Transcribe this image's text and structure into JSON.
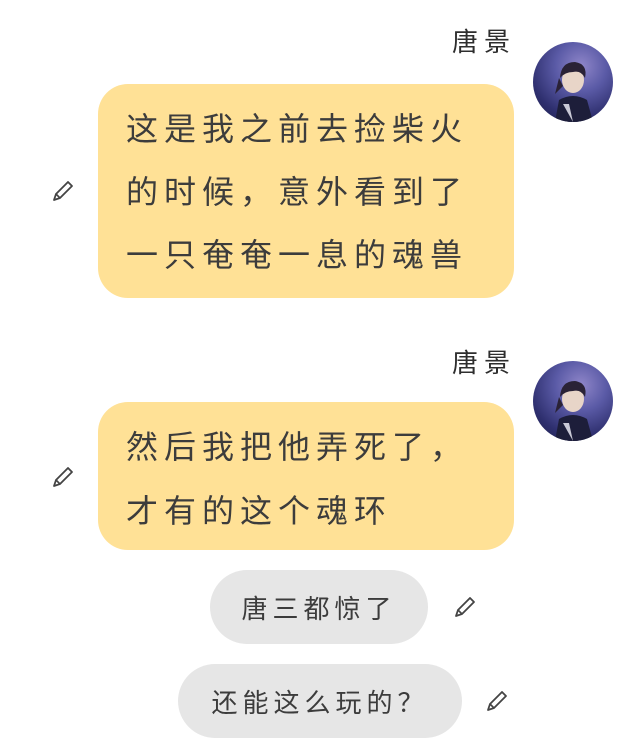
{
  "messages": [
    {
      "sender": "唐景",
      "lines": [
        "这是我之前去捡柴火",
        "的时候，意外看到了",
        "一只奄奄一息的魂兽"
      ],
      "edit_icon": "pencil-icon",
      "avatar": "avatar-icon"
    },
    {
      "sender": "唐景",
      "lines": [
        "然后我把他弄死了，",
        "才有的这个魂环"
      ],
      "edit_icon": "pencil-icon",
      "avatar": "avatar-icon"
    },
    {
      "text": "唐三都惊了",
      "edit_icon": "pencil-icon"
    },
    {
      "text": "还能这么玩的？",
      "edit_icon": "pencil-icon"
    }
  ],
  "colors": {
    "yellow_bubble": "#ffe196",
    "gray_bubble": "#e6e6e6"
  }
}
